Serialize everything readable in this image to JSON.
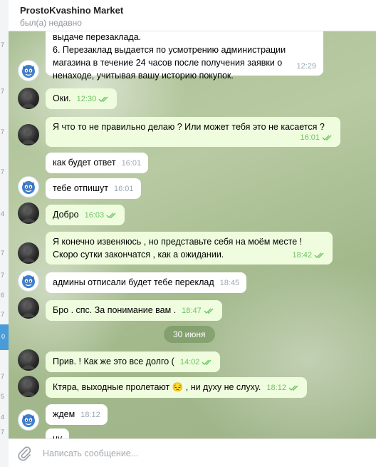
{
  "header": {
    "title": "ProstoKvashino Market",
    "status": "был(а) недавно"
  },
  "left_strip": {
    "numbers": [
      "7",
      "7",
      "7",
      "7",
      "4",
      "7",
      "7",
      "7",
      "6",
      "7",
      "5",
      "4",
      "7"
    ],
    "active_number": "0"
  },
  "messages": [
    {
      "side": "in",
      "avatar": "blue-mascot",
      "text": "выдаче перезаклада.\n6. Перезаклад выдается по усмотрению администрации\nмагазина в течение 24 часов после получения заявки о\nненаходе, учитывая вашу историю покупок.",
      "time": "12:29"
    },
    {
      "side": "out",
      "avatar": "dark-user",
      "text": "Оки.",
      "time": "12:30"
    },
    {
      "side": "out",
      "avatar": "dark-user",
      "text": "Я что то не правильно делаю ? Или может тебя это не касается ?",
      "time": "16:01"
    },
    {
      "side": "out",
      "avatar": "none",
      "text": "как будет ответ",
      "time": "16:01"
    },
    {
      "side": "in",
      "avatar": "blue-mascot",
      "text": "тебе отпишут",
      "time": "16:01"
    },
    {
      "side": "out",
      "avatar": "dark-user",
      "text": "Добро",
      "time": "16:03"
    },
    {
      "side": "out",
      "avatar": "dark-user",
      "text": "Я конечно извеняюсь , но представьте себя на моём месте !\nСкоро сутки закончатся , как а ожидании.",
      "time": "18:42"
    },
    {
      "side": "in",
      "avatar": "blue-mascot",
      "text": "админы отписали будет тебе переклад",
      "time": "18:45"
    },
    {
      "side": "out",
      "avatar": "dark-user",
      "text": "Бро . спс. За понимание вам .",
      "time": "18:47"
    },
    {
      "side": "out",
      "avatar": "dark-user",
      "text": "Прив. ! Как же это все долго (",
      "time": "14:02"
    },
    {
      "side": "out",
      "avatar": "dark-user",
      "text": "Ктяра, выходные пролетают 😔 , ни духу не слуху.",
      "time": "18:12"
    },
    {
      "side": "in",
      "avatar": "blue-mascot",
      "text": "ждем",
      "time": "18:12"
    },
    {
      "side": "in",
      "avatar": "none",
      "text": "ну",
      "time": ""
    }
  ],
  "date_separator": "30 июня",
  "composer": {
    "placeholder": "Написать сообщение..."
  },
  "colors": {
    "incoming_bubble": "#ffffff",
    "outgoing_bubble": "#effdde",
    "read_check": "#6cc264",
    "accent": "#4a9bd9"
  },
  "icons": [
    "paperclip-icon",
    "double-check-icon",
    "pensive-face-emoji"
  ]
}
